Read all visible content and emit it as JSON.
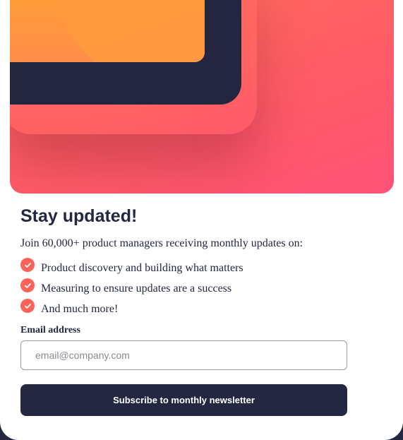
{
  "signup": {
    "title": "Stay updated!",
    "intro": "Join 60,000+ product managers receiving monthly updates on:",
    "benefits": [
      "Product discovery and building what matters",
      "Measuring to ensure updates are a success",
      "And much more!"
    ],
    "email_label": "Email address",
    "email_value": "",
    "email_placeholder": "email@company.com",
    "submit_label": "Subscribe to monthly newsletter"
  },
  "colors": {
    "accent": "#ff6257",
    "dark_navy": "#242742",
    "hero_top": "#ff6b5f",
    "hero_bottom": "#ff5276",
    "device_screen": "#ff9c3a"
  },
  "icons": {
    "check": "check-circle-icon"
  }
}
